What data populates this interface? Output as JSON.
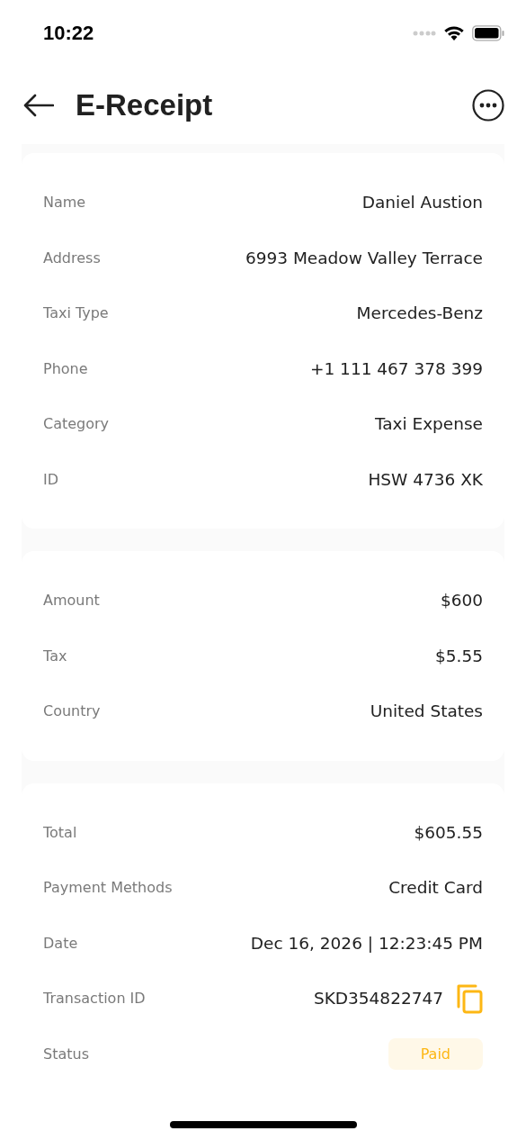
{
  "status_bar": {
    "time": "10:22"
  },
  "header": {
    "title": "E-Receipt"
  },
  "sections": [
    {
      "rows": [
        {
          "kind": "text",
          "label": "Name",
          "value": "Daniel Austion"
        },
        {
          "kind": "text",
          "label": "Address",
          "value": "6993 Meadow Valley Terrace"
        },
        {
          "kind": "text",
          "label": "Taxi Type",
          "value": "Mercedes-Benz"
        },
        {
          "kind": "text",
          "label": "Phone",
          "value": "+1 111 467 378 399"
        },
        {
          "kind": "text",
          "label": "Category",
          "value": "Taxi Expense"
        },
        {
          "kind": "text",
          "label": "ID",
          "value": "HSW 4736 XK"
        }
      ]
    },
    {
      "rows": [
        {
          "kind": "text",
          "label": "Amount",
          "value": "$600"
        },
        {
          "kind": "text",
          "label": "Tax",
          "value": "$5.55"
        },
        {
          "kind": "text",
          "label": "Country",
          "value": "United States"
        }
      ]
    },
    {
      "rows": [
        {
          "kind": "text",
          "label": "Total",
          "value": "$605.55"
        },
        {
          "kind": "text",
          "label": "Payment Methods",
          "value": "Credit Card"
        },
        {
          "kind": "text",
          "label": "Date",
          "value": "Dec 16, 2026 | 12:23:45 PM"
        },
        {
          "kind": "copy",
          "label": "Transaction ID",
          "value": "SKD354822747"
        },
        {
          "kind": "badge",
          "label": "Status",
          "value": "Paid"
        }
      ]
    }
  ]
}
